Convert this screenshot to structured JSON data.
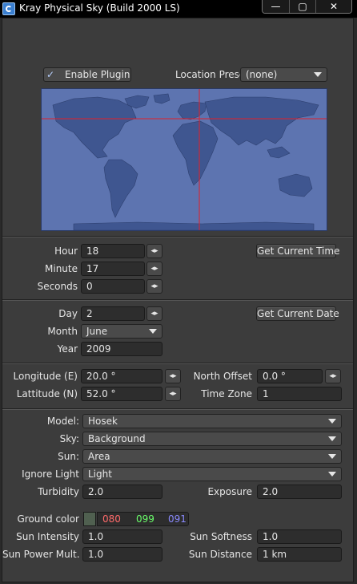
{
  "window": {
    "title": "Kray Physical Sky (Build 2000 LS)",
    "minimize_glyph": "—",
    "maximize_glyph": "▢",
    "close_glyph": "✕"
  },
  "plugin": {
    "enable_label": "Enable Plugin",
    "enabled": true,
    "check_glyph": "✓",
    "location_preset_label": "Location Preset",
    "location_preset_value": "(none)"
  },
  "time": {
    "hour_label": "Hour",
    "hour_value": "18",
    "minute_label": "Minute",
    "minute_value": "17",
    "seconds_label": "Seconds",
    "seconds_value": "0",
    "get_current_time": "Get Current Time"
  },
  "date": {
    "day_label": "Day",
    "day_value": "2",
    "month_label": "Month",
    "month_value": "June",
    "year_label": "Year",
    "year_value": "2009",
    "get_current_date": "Get Current Date"
  },
  "location": {
    "longitude_label": "Longitude (E)",
    "longitude_value": "20.0 °",
    "latitude_label": "Lattitude (N)",
    "latitude_value": "52.0 °",
    "north_offset_label": "North Offset",
    "north_offset_value": "0.0 °",
    "time_zone_label": "Time Zone",
    "time_zone_value": "1"
  },
  "sky": {
    "model_label": "Model:",
    "model_value": "Hosek",
    "sky_label": "Sky:",
    "sky_value": "Background",
    "sun_label": "Sun:",
    "sun_value": "Area",
    "ignore_light_label": "Ignore Light",
    "ignore_light_value": "Light",
    "turbidity_label": "Turbidity",
    "turbidity_value": "2.0",
    "exposure_label": "Exposure",
    "exposure_value": "2.0"
  },
  "sun": {
    "ground_color_label": "Ground color",
    "ground_r": "080",
    "ground_g": "099",
    "ground_b": "091",
    "ground_swatch": "#506050",
    "intensity_label": "Sun Intensity",
    "intensity_value": "1.0",
    "softness_label": "Sun Softness",
    "softness_value": "1.0",
    "power_label": "Sun Power Mult.",
    "power_value": "1.0",
    "distance_label": "Sun Distance",
    "distance_value": "1 km"
  },
  "icons": {
    "spinner": "arrows-horizontal-icon",
    "dropdown": "chevron-down-icon"
  },
  "colors": {
    "map_fill": "#5d74b0",
    "crosshair": "#e0202a",
    "red_channel": "#ff6a6a",
    "green_channel": "#6aff6a",
    "blue_channel": "#8a8aff"
  }
}
